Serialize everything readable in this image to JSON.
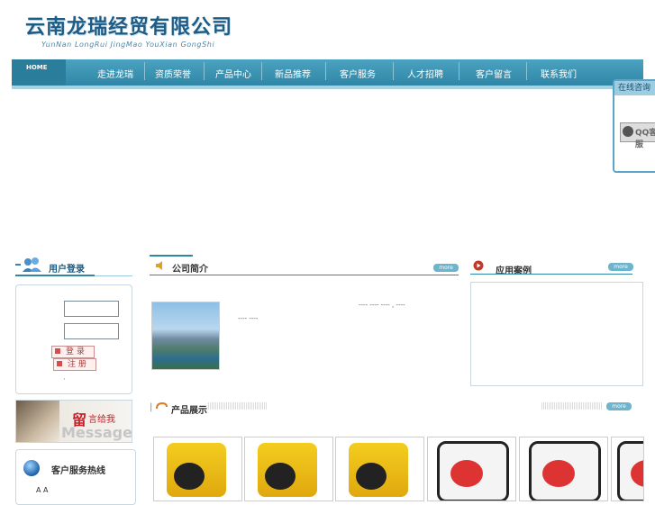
{
  "header": {
    "company_cn": "云南龙瑞经贸有限公司",
    "company_en": "YunNan LongRui JingMao YouXian GongShi"
  },
  "nav": {
    "home": "HOME",
    "items": [
      "走进龙瑞",
      "资质荣誉",
      "产品中心",
      "新品推荐",
      "客户服务",
      "人才招聘",
      "客户留言",
      "联系我们"
    ]
  },
  "float_chat": {
    "title": "在线咨询",
    "qq_label": "QQ客服"
  },
  "sidebar": {
    "login_title": "用户登录",
    "login_button": "登 录",
    "register_button": "注 册",
    "dot": "·",
    "message_banner": {
      "big": "留",
      "rest": "言给我",
      "en": "Message"
    },
    "hotline_title": "客户服务热线",
    "hotline_text": "A A"
  },
  "main": {
    "about_title": "公司简介",
    "about_more": "more",
    "about_line1": "----  ----       ---- ,  ----",
    "about_line2": "----  ----",
    "products_title": "产品展示",
    "products_more": "more"
  },
  "right": {
    "cases_title": "应用案例",
    "cases_more": "more"
  },
  "colors": {
    "nav": "#3a93b3",
    "accent": "#1d5c86",
    "chat_border": "#5aa5c8"
  }
}
